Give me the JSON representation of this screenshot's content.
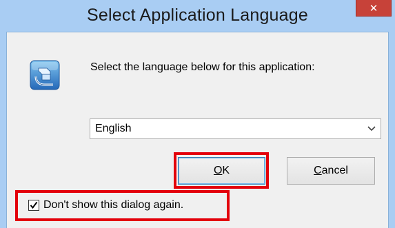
{
  "window": {
    "title": "Select Application Language",
    "close_glyph": "✕",
    "close_icon": "close-icon"
  },
  "dialog": {
    "icon": "application-installer-icon",
    "prompt": "Select the language below for this application:",
    "language_select": {
      "value": "English",
      "icon": "chevron-down-icon"
    },
    "buttons": {
      "ok_access_key": "O",
      "ok_rest": "K",
      "cancel_access_key": "C",
      "cancel_rest": "ancel"
    },
    "dont_show_again": {
      "label": "Don't show this dialog again.",
      "checked": true
    }
  },
  "colors": {
    "title_bar": "#a9cdf3",
    "close_button": "#c74239",
    "client_background": "#f0f0f0",
    "highlight": "#e3000b"
  }
}
